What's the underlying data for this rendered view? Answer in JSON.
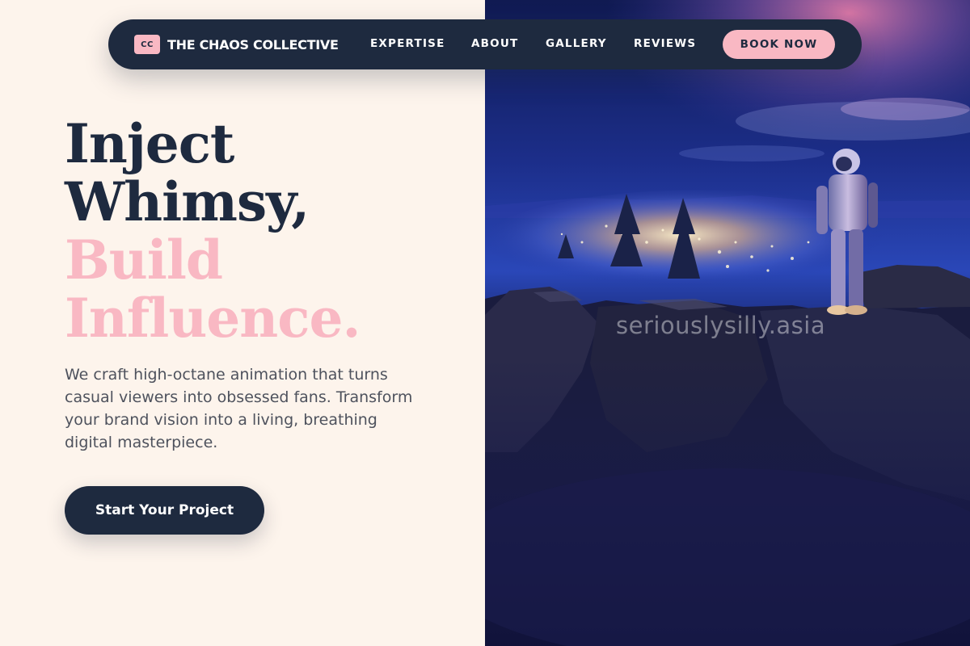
{
  "brand": {
    "badge": "CC",
    "name": "THE CHAOS COLLECTIVE"
  },
  "nav": {
    "links": [
      "EXPERTISE",
      "ABOUT",
      "GALLERY",
      "REVIEWS"
    ],
    "cta": "BOOK NOW"
  },
  "hero": {
    "headline": [
      "Inject",
      "Whimsy,",
      "Build",
      "Influence."
    ],
    "subcopy": "We craft high-octane animation that turns casual viewers into obsessed fans. Transform your brand vision into a living, breathing digital masterpiece.",
    "cta": "Start Your Project"
  },
  "image": {
    "watermark": "seriouslysilly.asia"
  },
  "colors": {
    "navy": "#1e2a3f",
    "pink": "#f9b8c3",
    "cream": "#fdf4ec",
    "body_text": "#4e525d"
  }
}
